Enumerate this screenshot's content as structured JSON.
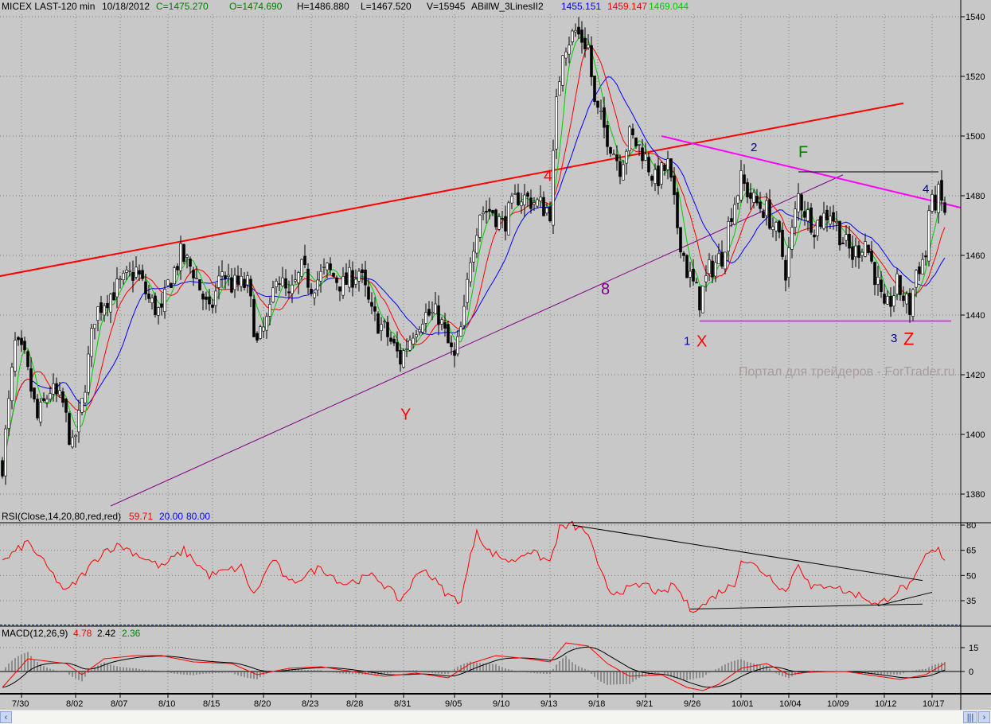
{
  "header": {
    "symbol": "MICEX LAST-120 min",
    "date": "10/18/2012",
    "close": "C=1475.270",
    "open": "O=1474.690",
    "high": "H=1486.880",
    "low": "L=1467.520",
    "volume": "V=15945",
    "indicator": "ABillW_3LinesII2",
    "ind_blue": "1455.151",
    "ind_red": "1459.147",
    "ind_green": "1469.044"
  },
  "rsi_header": {
    "name": "RSI(Close,14,20,80,red,red)",
    "value": "59.71",
    "low": "20.00",
    "high": "80.00"
  },
  "macd_header": {
    "name": "MACD(12,26,9)",
    "macd": "4.78",
    "signal": "2.42",
    "hist": "2.36"
  },
  "watermark": "Портал для трейдеров - ForTrader.ru",
  "colors": {
    "background": "#c8c8c8",
    "ma_blue": "#0000ff",
    "ma_red": "#ff0000",
    "ma_green": "#00cc00",
    "trend_red": "#ff0000",
    "trend_magenta": "#ff00ff",
    "trend_purple": "#800080"
  },
  "chart_data": {
    "type": "candlestick",
    "bars": 297,
    "price_axis": {
      "ticks": [
        "1540",
        "1520",
        "1500",
        "1480",
        "1460",
        "1440",
        "1420",
        "1400",
        "1380"
      ],
      "ylim": [
        1372,
        1545
      ]
    },
    "date_ticks": [
      {
        "bar": 6,
        "label": "7/30"
      },
      {
        "bar": 23,
        "label": "8/02"
      },
      {
        "bar": 37,
        "label": "8/07"
      },
      {
        "bar": 52,
        "label": "8/10"
      },
      {
        "bar": 66,
        "label": "8/15"
      },
      {
        "bar": 82,
        "label": "8/20"
      },
      {
        "bar": 97,
        "label": "8/23"
      },
      {
        "bar": 111,
        "label": "8/28"
      },
      {
        "bar": 126,
        "label": "8/31"
      },
      {
        "bar": 142,
        "label": "9/05"
      },
      {
        "bar": 157,
        "label": "9/10"
      },
      {
        "bar": 172,
        "label": "9/13"
      },
      {
        "bar": 187,
        "label": "9/18"
      },
      {
        "bar": 202,
        "label": "9/21"
      },
      {
        "bar": 217,
        "label": "9/26"
      },
      {
        "bar": 232,
        "label": "10/01"
      },
      {
        "bar": 247,
        "label": "10/04"
      },
      {
        "bar": 262,
        "label": "10/09"
      },
      {
        "bar": 277,
        "label": "10/12"
      },
      {
        "bar": 292,
        "label": "10/17"
      }
    ],
    "close_keypoints": [
      [
        0,
        1390
      ],
      [
        4,
        1430
      ],
      [
        7,
        1425
      ],
      [
        11,
        1405
      ],
      [
        15,
        1415
      ],
      [
        19,
        1410
      ],
      [
        22,
        1395
      ],
      [
        25,
        1410
      ],
      [
        29,
        1440
      ],
      [
        32,
        1445
      ],
      [
        37,
        1450
      ],
      [
        42,
        1455
      ],
      [
        46,
        1445
      ],
      [
        50,
        1440
      ],
      [
        52,
        1450
      ],
      [
        56,
        1460
      ],
      [
        60,
        1455
      ],
      [
        65,
        1440
      ],
      [
        69,
        1455
      ],
      [
        72,
        1450
      ],
      [
        77,
        1450
      ],
      [
        80,
        1430
      ],
      [
        84,
        1440
      ],
      [
        86,
        1455
      ],
      [
        90,
        1445
      ],
      [
        94,
        1455
      ],
      [
        97,
        1450
      ],
      [
        102,
        1455
      ],
      [
        107,
        1450
      ],
      [
        112,
        1455
      ],
      [
        116,
        1440
      ],
      [
        120,
        1435
      ],
      [
        125,
        1425
      ],
      [
        129,
        1435
      ],
      [
        132,
        1440
      ],
      [
        137,
        1440
      ],
      [
        140,
        1430
      ],
      [
        142,
        1425
      ],
      [
        145,
        1440
      ],
      [
        147,
        1460
      ],
      [
        150,
        1475
      ],
      [
        154,
        1475
      ],
      [
        157,
        1470
      ],
      [
        162,
        1480
      ],
      [
        167,
        1478
      ],
      [
        172,
        1475
      ],
      [
        174,
        1510
      ],
      [
        176,
        1530
      ],
      [
        180,
        1535
      ],
      [
        184,
        1530
      ],
      [
        186,
        1510
      ],
      [
        190,
        1500
      ],
      [
        194,
        1490
      ],
      [
        197,
        1500
      ],
      [
        201,
        1495
      ],
      [
        205,
        1485
      ],
      [
        209,
        1490
      ],
      [
        212,
        1470
      ],
      [
        215,
        1455
      ],
      [
        219,
        1445
      ],
      [
        222,
        1455
      ],
      [
        226,
        1460
      ],
      [
        229,
        1475
      ],
      [
        232,
        1485
      ],
      [
        236,
        1478
      ],
      [
        240,
        1475
      ],
      [
        244,
        1465
      ],
      [
        246,
        1455
      ],
      [
        250,
        1480
      ],
      [
        252,
        1475
      ],
      [
        255,
        1470
      ],
      [
        260,
        1475
      ],
      [
        264,
        1465
      ],
      [
        267,
        1460
      ],
      [
        271,
        1465
      ],
      [
        275,
        1450
      ],
      [
        277,
        1440
      ],
      [
        281,
        1450
      ],
      [
        285,
        1442
      ],
      [
        287,
        1455
      ],
      [
        290,
        1460
      ],
      [
        291,
        1475
      ],
      [
        294,
        1480
      ],
      [
        296,
        1475
      ]
    ],
    "trendlines": [
      {
        "name": "red-resistance",
        "color": "#ff0000",
        "width": 2,
        "from": [
          -1,
          1453
        ],
        "to": [
          283,
          1511
        ]
      },
      {
        "name": "purple-support",
        "color": "#800080",
        "width": 1,
        "from": [
          34,
          1376
        ],
        "to": [
          264,
          1487
        ]
      },
      {
        "name": "magenta-resistance",
        "color": "#ff00ff",
        "width": 2,
        "from": [
          207,
          1500
        ],
        "to": [
          301,
          1476
        ]
      },
      {
        "name": "magenta-support",
        "color": "#ff00ff",
        "width": 1.5,
        "from": [
          219,
          1438
        ],
        "to": [
          298,
          1438
        ]
      },
      {
        "name": "black-high",
        "color": "#000000",
        "width": 1,
        "from": [
          250,
          1488
        ],
        "to": [
          294,
          1488
        ]
      }
    ],
    "annotations": [
      {
        "text": "4",
        "bar": 170,
        "price": 1485,
        "color": "#ff0000",
        "size": 20
      },
      {
        "text": "8",
        "bar": 188,
        "price": 1447,
        "color": "#800080",
        "size": 20
      },
      {
        "text": "Y",
        "bar": 125,
        "price": 1405,
        "color": "#ff0000",
        "size": 20
      },
      {
        "text": "1",
        "bar": 214,
        "price": 1430,
        "color": "#0000cc",
        "size": 15
      },
      {
        "text": "X",
        "bar": 218,
        "price": 1429.5,
        "color": "#ff0000",
        "size": 20
      },
      {
        "text": "2",
        "bar": 235,
        "price": 1495,
        "color": "#000080",
        "size": 15
      },
      {
        "text": "F",
        "bar": 250,
        "price": 1493,
        "color": "#008000",
        "size": 20
      },
      {
        "text": "4",
        "bar": 289,
        "price": 1481,
        "color": "#000080",
        "size": 15
      },
      {
        "text": "3",
        "bar": 279,
        "price": 1431,
        "color": "#000080",
        "size": 15
      },
      {
        "text": "Z",
        "bar": 283,
        "price": 1430,
        "color": "#ff0000",
        "size": 22
      }
    ],
    "rsi": {
      "ticks": [
        "80",
        "65",
        "50",
        "35"
      ],
      "ylim": [
        19,
        84
      ],
      "keypoints": [
        [
          0,
          58
        ],
        [
          8,
          70
        ],
        [
          20,
          40
        ],
        [
          25,
          50
        ],
        [
          32,
          65
        ],
        [
          37,
          68
        ],
        [
          45,
          60
        ],
        [
          50,
          55
        ],
        [
          57,
          65
        ],
        [
          65,
          50
        ],
        [
          75,
          55
        ],
        [
          79,
          38
        ],
        [
          85,
          60
        ],
        [
          90,
          45
        ],
        [
          100,
          55
        ],
        [
          107,
          45
        ],
        [
          117,
          50
        ],
        [
          125,
          35
        ],
        [
          132,
          55
        ],
        [
          140,
          38
        ],
        [
          144,
          35
        ],
        [
          149,
          78
        ],
        [
          152,
          65
        ],
        [
          160,
          58
        ],
        [
          165,
          65
        ],
        [
          172,
          58
        ],
        [
          175,
          78
        ],
        [
          179,
          80
        ],
        [
          184,
          75
        ],
        [
          187,
          55
        ],
        [
          191,
          40
        ],
        [
          197,
          42
        ],
        [
          202,
          45
        ],
        [
          207,
          38
        ],
        [
          211,
          45
        ],
        [
          216,
          30
        ],
        [
          220,
          32
        ],
        [
          225,
          40
        ],
        [
          230,
          45
        ],
        [
          232,
          60
        ],
        [
          237,
          55
        ],
        [
          242,
          48
        ],
        [
          246,
          40
        ],
        [
          250,
          58
        ],
        [
          254,
          42
        ],
        [
          260,
          45
        ],
        [
          265,
          40
        ],
        [
          270,
          38
        ],
        [
          275,
          32
        ],
        [
          279,
          38
        ],
        [
          282,
          42
        ],
        [
          286,
          45
        ],
        [
          290,
          62
        ],
        [
          294,
          65
        ],
        [
          296,
          60
        ]
      ],
      "trendlines": [
        {
          "from": [
            179,
            80
          ],
          "to": [
            289,
            47
          ]
        },
        {
          "from": [
            216,
            30
          ],
          "to": [
            289,
            33
          ]
        },
        {
          "from": [
            275,
            32
          ],
          "to": [
            292,
            40
          ]
        }
      ]
    },
    "macd": {
      "ticks": [
        "15",
        "0"
      ],
      "ylim": [
        -14,
        22
      ],
      "keypoints": [
        [
          0,
          -10
        ],
        [
          8,
          8
        ],
        [
          20,
          5
        ],
        [
          25,
          -2
        ],
        [
          32,
          8
        ],
        [
          42,
          10
        ],
        [
          50,
          10
        ],
        [
          60,
          6
        ],
        [
          72,
          5
        ],
        [
          80,
          -2
        ],
        [
          90,
          2
        ],
        [
          100,
          3
        ],
        [
          110,
          0
        ],
        [
          120,
          -3
        ],
        [
          130,
          -1
        ],
        [
          140,
          -4
        ],
        [
          147,
          5
        ],
        [
          155,
          10
        ],
        [
          165,
          8
        ],
        [
          172,
          6
        ],
        [
          177,
          18
        ],
        [
          184,
          16
        ],
        [
          190,
          5
        ],
        [
          197,
          -3
        ],
        [
          207,
          -2
        ],
        [
          215,
          -10
        ],
        [
          220,
          -12
        ],
        [
          225,
          -8
        ],
        [
          232,
          2
        ],
        [
          240,
          5
        ],
        [
          247,
          -2
        ],
        [
          255,
          0
        ],
        [
          265,
          0
        ],
        [
          275,
          -3
        ],
        [
          282,
          -5
        ],
        [
          290,
          -2
        ],
        [
          296,
          5
        ]
      ]
    }
  }
}
